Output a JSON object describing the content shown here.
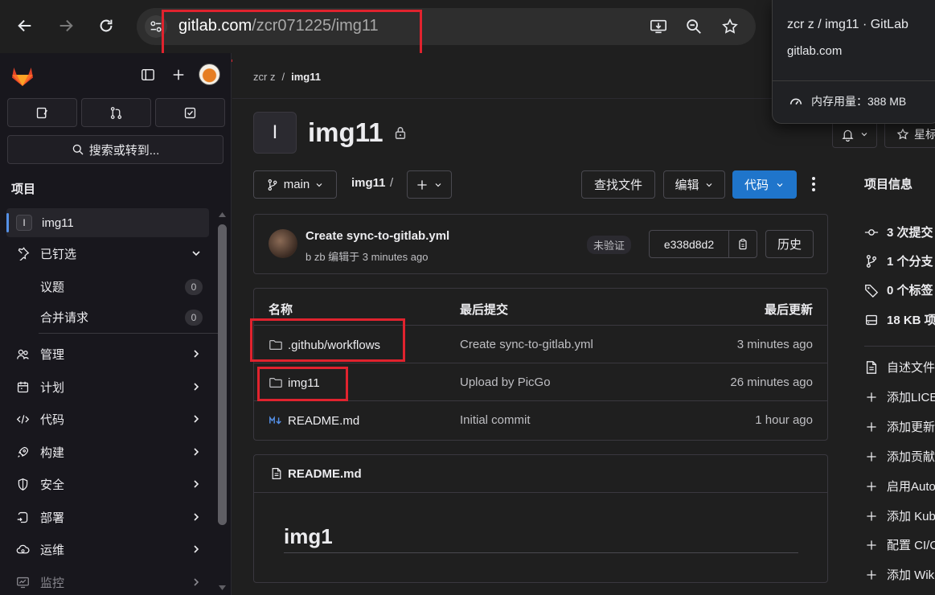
{
  "browser": {
    "url_host": "gitlab.com",
    "url_path": "/zcr071225/img11",
    "hover_card": {
      "title": "zcr z / img11 · GitLab",
      "host": "gitlab.com",
      "memory": "内存用量：388 MB"
    }
  },
  "sidebar": {
    "search_label": "搜索或转到...",
    "section_title": "项目",
    "project_badge": "I",
    "project_name": "img11",
    "pinned_label": "已钉选",
    "pinned_items": [
      {
        "label": "议题",
        "count": "0"
      },
      {
        "label": "合并请求",
        "count": "0"
      }
    ],
    "nav_items": [
      {
        "label": "管理",
        "icon": "users-icon"
      },
      {
        "label": "计划",
        "icon": "calendar-icon"
      },
      {
        "label": "代码",
        "icon": "code-icon"
      },
      {
        "label": "构建",
        "icon": "rocket-icon"
      },
      {
        "label": "安全",
        "icon": "shield-icon"
      },
      {
        "label": "部署",
        "icon": "deploy-icon"
      },
      {
        "label": "运维",
        "icon": "cloud-gear-icon"
      },
      {
        "label": "监控",
        "icon": "monitor-icon"
      }
    ]
  },
  "breadcrumb": {
    "owner": "zcr z",
    "separator": "/",
    "project": "img11"
  },
  "project": {
    "avatar_letter": "I",
    "title": "img11",
    "star_label": "星标"
  },
  "toolbar": {
    "branch": "main",
    "path": "img11",
    "path_sep": "/",
    "find_file": "查找文件",
    "edit": "编辑",
    "code": "代码"
  },
  "last_commit": {
    "message": "Create sync-to-gitlab.yml",
    "meta": "b zb 编辑于 3 minutes ago",
    "status": "未验证",
    "sha": "e338d8d2",
    "history": "历史"
  },
  "file_table": {
    "headers": [
      "名称",
      "最后提交",
      "最后更新"
    ],
    "rows": [
      {
        "icon": "folder-icon",
        "name": ".github/workflows",
        "commit": "Create sync-to-gitlab.yml",
        "updated": "3 minutes ago"
      },
      {
        "icon": "folder-icon",
        "name": "img11",
        "commit": "Upload by PicGo",
        "updated": "26 minutes ago"
      },
      {
        "icon": "markdown-icon",
        "name": "README.md",
        "commit": "Initial commit",
        "updated": "1 hour ago"
      }
    ]
  },
  "readme": {
    "filename": "README.md",
    "heading": "img1"
  },
  "project_info": {
    "title": "项目信息",
    "stats": [
      {
        "icon": "commit-icon",
        "label": "3 次提交"
      },
      {
        "icon": "branch-icon",
        "label": "1 个分支"
      },
      {
        "icon": "tag-icon",
        "label": "0 个标签"
      },
      {
        "icon": "storage-icon",
        "label": "18 KB 项"
      }
    ],
    "readme_link": "自述文件",
    "add_links": [
      "添加LICE",
      "添加更新",
      "添加贡献",
      "启用Auto",
      "添加 Kub",
      "配置 CI/C",
      "添加 Wik"
    ]
  }
}
